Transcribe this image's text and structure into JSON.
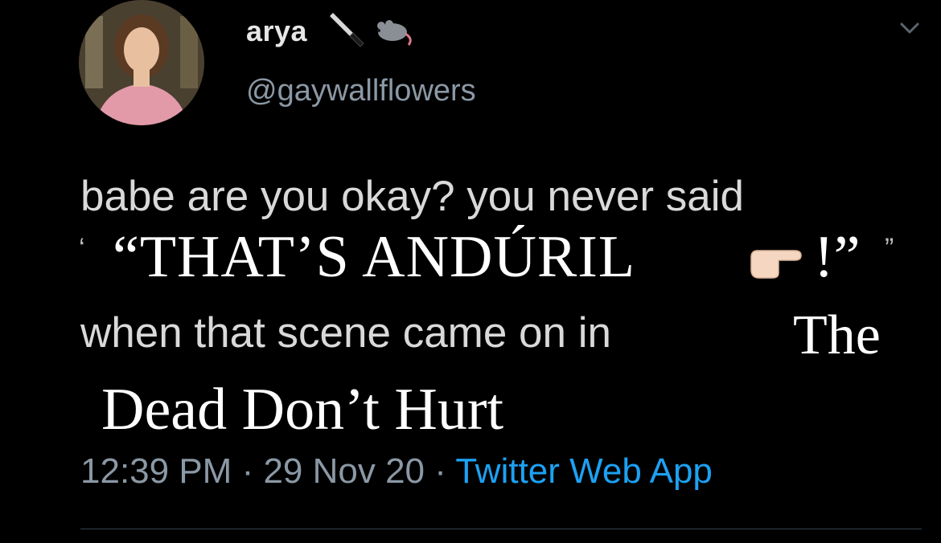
{
  "user": {
    "display_name": "arya",
    "name_emojis": [
      "knife-icon",
      "rat-icon"
    ],
    "handle": "@gaywallflowers",
    "avatar": "avatar"
  },
  "tweet": {
    "line1": "babe are you okay? you never said",
    "open_quote_small": "‘",
    "quote_main": "“THAT’S ANDÚRIL",
    "quote_end": "!”",
    "close_quote_small": "”",
    "line3": "when that scene came on in",
    "overlay_the": "The",
    "overlay_title": "Dead Don’t Hurt"
  },
  "meta": {
    "time": "12:39 PM",
    "sep1": " · ",
    "date": "29 Nov 20",
    "sep2": " · ",
    "source": "Twitter Web App"
  },
  "colors": {
    "background": "#000000",
    "text": "#d9d9d9",
    "muted": "#8b98a5",
    "link": "#1da1f2",
    "overlay_text": "#ffffff"
  }
}
